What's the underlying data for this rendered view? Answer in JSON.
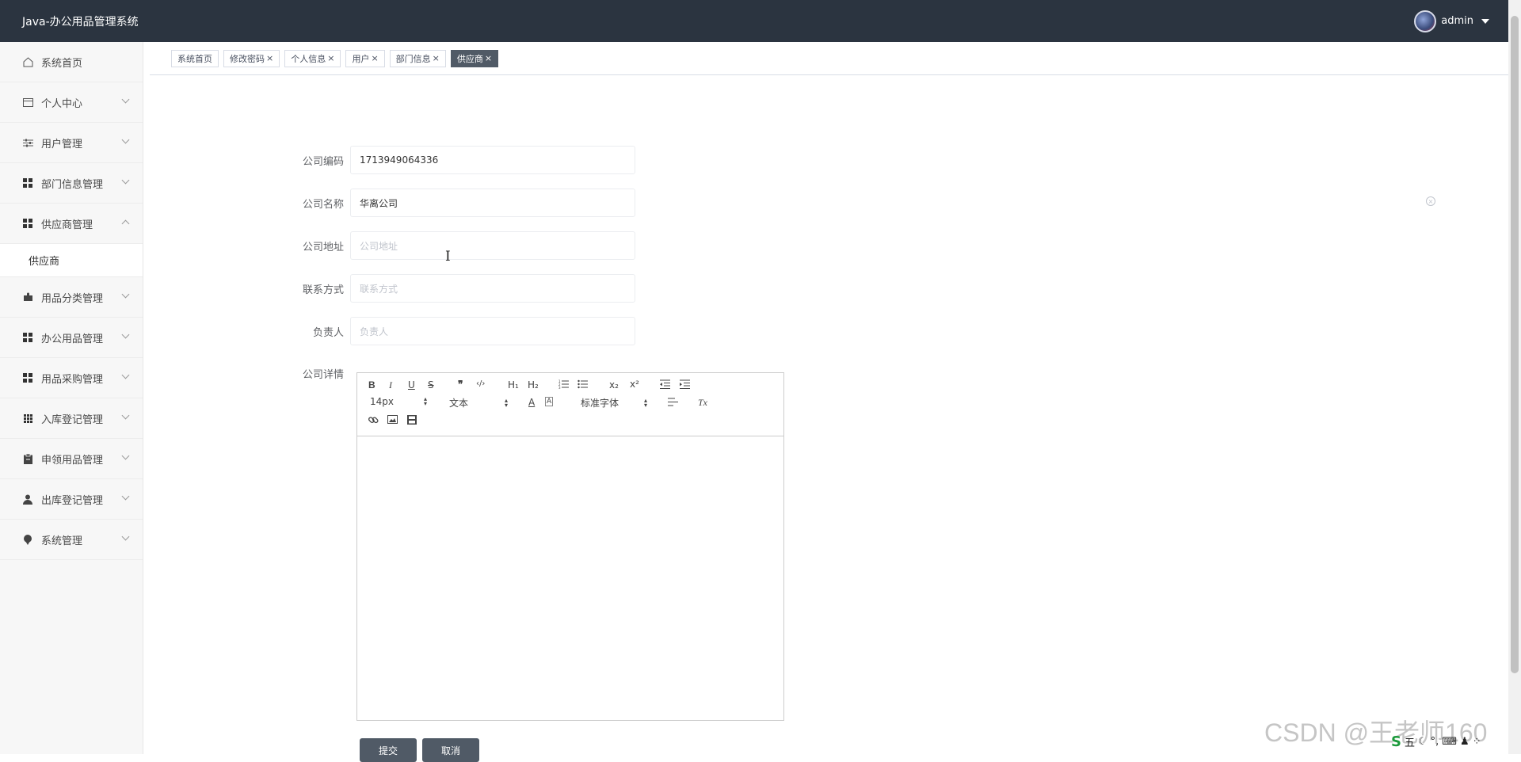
{
  "header": {
    "app_title": "Java-办公用品管理系统",
    "username": "admin"
  },
  "sidebar": {
    "items": [
      {
        "label": "系统首页",
        "icon": "home-icon"
      },
      {
        "label": "个人中心",
        "icon": "card-icon"
      },
      {
        "label": "用户管理",
        "icon": "sliders-icon"
      },
      {
        "label": "部门信息管理",
        "icon": "grid-icon"
      },
      {
        "label": "供应商管理",
        "icon": "grid-icon"
      },
      {
        "label": "用品分类管理",
        "icon": "puzzle-icon"
      },
      {
        "label": "办公用品管理",
        "icon": "grid-icon"
      },
      {
        "label": "用品采购管理",
        "icon": "grid-icon"
      },
      {
        "label": "入库登记管理",
        "icon": "apps-icon"
      },
      {
        "label": "申领用品管理",
        "icon": "clipboard-icon"
      },
      {
        "label": "出库登记管理",
        "icon": "user-icon"
      },
      {
        "label": "系统管理",
        "icon": "pin-icon"
      }
    ],
    "subitem": "供应商"
  },
  "tabs": [
    {
      "label": "系统首页"
    },
    {
      "label": "修改密码"
    },
    {
      "label": "个人信息"
    },
    {
      "label": "用户"
    },
    {
      "label": "部门信息"
    },
    {
      "label": "供应商"
    }
  ],
  "form": {
    "code_label": "公司编码",
    "code_value": "1713949064336",
    "name_label": "公司名称",
    "name_value": "华离公司",
    "address_label": "公司地址",
    "address_placeholder": "公司地址",
    "contact_label": "联系方式",
    "contact_placeholder": "联系方式",
    "owner_label": "负责人",
    "owner_placeholder": "负责人",
    "detail_label": "公司详情"
  },
  "editor": {
    "font_size": "14px",
    "header_select": "文本",
    "font_family": "标准字体",
    "h1": "H₁",
    "h2": "H₂",
    "sub": "x₂",
    "sup": "x²",
    "quote": "❞",
    "code": "‹/›",
    "clear_format": "Tx"
  },
  "buttons": {
    "submit": "提交",
    "cancel": "取消"
  },
  "watermark": "CSDN @王老师160",
  "tray": {
    "s5": "S",
    "ime": "五"
  }
}
